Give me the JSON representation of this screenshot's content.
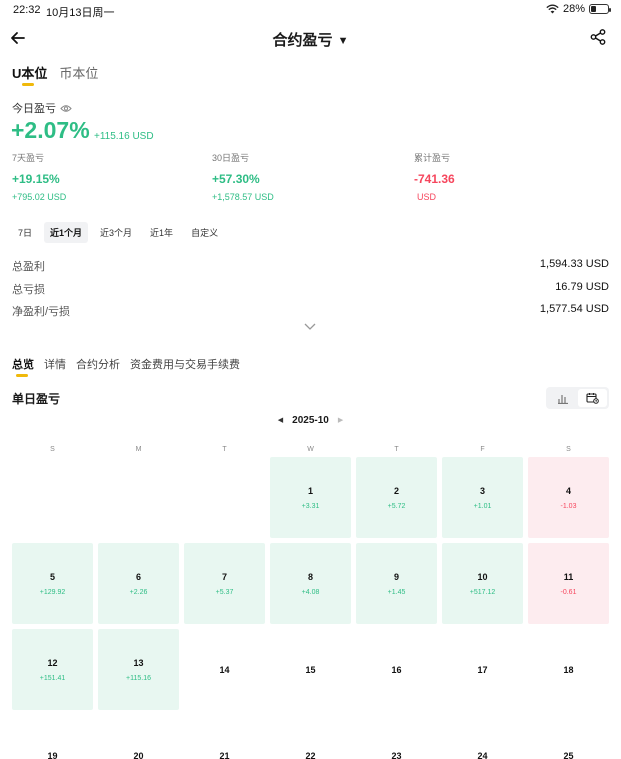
{
  "status_bar": {
    "time": "22:32",
    "date": "10月13日周一",
    "battery": "28%"
  },
  "header": {
    "title": "合约盈亏"
  },
  "unit_tabs": [
    {
      "label": "U本位",
      "active": true
    },
    {
      "label": "币本位",
      "active": false
    }
  ],
  "today": {
    "label": "今日盈亏",
    "pct": "+2.07%",
    "usd": "+115.16 USD"
  },
  "stats": {
    "d7": {
      "label": "7天盈亏",
      "pct": "+19.15%",
      "usd": "+795.02 USD"
    },
    "d30": {
      "label": "30日盈亏",
      "pct": "+57.30%",
      "usd": "+1,578.57 USD"
    },
    "cum": {
      "label": "累计盈亏",
      "value": "-741.36",
      "unit": "USD"
    }
  },
  "range_tabs": [
    "7日",
    "近1个月",
    "近3个月",
    "近1年",
    "自定义"
  ],
  "range_active": "近1个月",
  "summary": {
    "profit": {
      "label": "总盈利",
      "value": "1,594.33 USD"
    },
    "loss": {
      "label": "总亏损",
      "value": "16.79 USD"
    },
    "net": {
      "label": "净盈利/亏损",
      "value": "1,577.54 USD"
    }
  },
  "section_tabs": [
    "总览",
    "详情",
    "合约分析",
    "资金费用与交易手续费"
  ],
  "section_active": "总览",
  "daily": {
    "title": "单日盈亏",
    "month": "2025-10"
  },
  "weekdays": [
    "S",
    "M",
    "T",
    "W",
    "T",
    "F",
    "S"
  ],
  "calendar": [
    {
      "day": "",
      "pnl": "",
      "type": "empty"
    },
    {
      "day": "",
      "pnl": "",
      "type": "empty"
    },
    {
      "day": "",
      "pnl": "",
      "type": "empty"
    },
    {
      "day": "1",
      "pnl": "+3.31",
      "type": "pos"
    },
    {
      "day": "2",
      "pnl": "+5.72",
      "type": "pos"
    },
    {
      "day": "3",
      "pnl": "+1.01",
      "type": "pos"
    },
    {
      "day": "4",
      "pnl": "-1.03",
      "type": "neg"
    },
    {
      "day": "5",
      "pnl": "+129.92",
      "type": "pos"
    },
    {
      "day": "6",
      "pnl": "+2.26",
      "type": "pos"
    },
    {
      "day": "7",
      "pnl": "+5.37",
      "type": "pos"
    },
    {
      "day": "8",
      "pnl": "+4.08",
      "type": "pos"
    },
    {
      "day": "9",
      "pnl": "+1.45",
      "type": "pos"
    },
    {
      "day": "10",
      "pnl": "+517.12",
      "type": "pos"
    },
    {
      "day": "11",
      "pnl": "-0.61",
      "type": "neg"
    },
    {
      "day": "12",
      "pnl": "+151.41",
      "type": "pos"
    },
    {
      "day": "13",
      "pnl": "+115.16",
      "type": "pos"
    },
    {
      "day": "14",
      "pnl": "",
      "type": "plain"
    },
    {
      "day": "15",
      "pnl": "",
      "type": "plain"
    },
    {
      "day": "16",
      "pnl": "",
      "type": "plain"
    },
    {
      "day": "17",
      "pnl": "",
      "type": "plain"
    },
    {
      "day": "18",
      "pnl": "",
      "type": "plain"
    },
    {
      "day": "19",
      "pnl": "",
      "type": "plain"
    },
    {
      "day": "20",
      "pnl": "",
      "type": "plain"
    },
    {
      "day": "21",
      "pnl": "",
      "type": "plain"
    },
    {
      "day": "22",
      "pnl": "",
      "type": "plain"
    },
    {
      "day": "23",
      "pnl": "",
      "type": "plain"
    },
    {
      "day": "24",
      "pnl": "",
      "type": "plain"
    },
    {
      "day": "25",
      "pnl": "",
      "type": "plain"
    }
  ],
  "colors": {
    "profit": "#2ebd85",
    "loss": "#f6465d",
    "accent": "#f0b90b"
  }
}
